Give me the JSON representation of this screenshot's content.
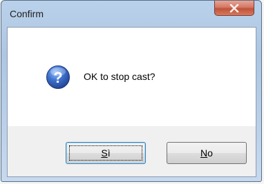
{
  "window": {
    "title": "Confirm"
  },
  "message": {
    "text": "OK to stop cast?",
    "icon": "question-icon"
  },
  "buttons": {
    "yes": {
      "mnemonic": "S",
      "rest": "ì",
      "is_default": true
    },
    "no": {
      "mnemonic": "N",
      "rest": "o",
      "is_default": false
    }
  },
  "colors": {
    "close_button": "#c0523b",
    "icon_blue": "#2f5fb8"
  }
}
